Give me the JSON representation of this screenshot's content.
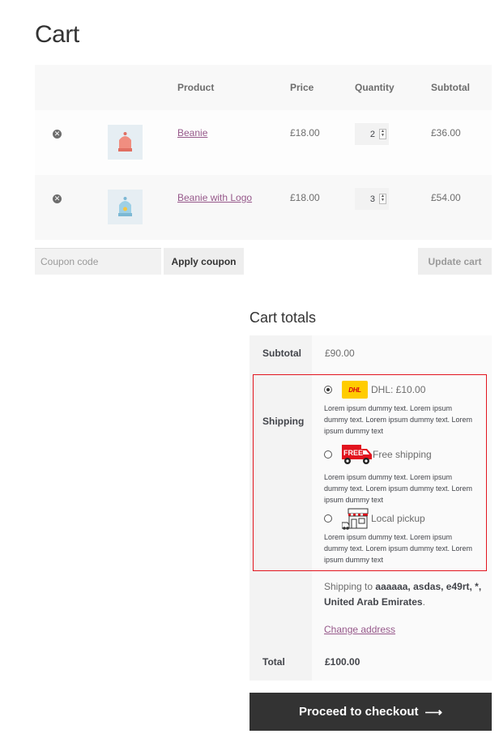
{
  "page": {
    "title": "Cart"
  },
  "cart_table": {
    "headers": {
      "product": "Product",
      "price": "Price",
      "quantity": "Quantity",
      "subtotal": "Subtotal"
    },
    "rows": [
      {
        "product": "Beanie",
        "price": "£18.00",
        "quantity": "2",
        "subtotal": "£36.00",
        "thumb_color": "#f08e80",
        "remove_icon": "close-circle-icon"
      },
      {
        "product": "Beanie with Logo",
        "price": "£18.00",
        "quantity": "3",
        "subtotal": "£54.00",
        "thumb_color": "#9ed0e6",
        "remove_icon": "close-circle-icon"
      }
    ]
  },
  "coupon": {
    "placeholder": "Coupon code",
    "value": "",
    "apply_label": "Apply coupon"
  },
  "update_label": "Update cart",
  "totals": {
    "title": "Cart totals",
    "subtotal_label": "Subtotal",
    "subtotal_value": "£90.00",
    "shipping_label": "Shipping",
    "shipping_options": [
      {
        "label": "DHL: £10.00",
        "selected": true,
        "icon": "dhl-logo-icon",
        "description": "Lorem ipsum dummy text. Lorem ipsum dummy text. Lorem ipsum dummy text. Lorem ipsum dummy text"
      },
      {
        "label": "Free shipping",
        "selected": false,
        "icon": "free-shipping-truck-icon",
        "description": "Lorem ipsum dummy text. Lorem ipsum dummy text. Lorem ipsum dummy text. Lorem ipsum dummy text"
      },
      {
        "label": "Local pickup",
        "selected": false,
        "icon": "store-pickup-icon",
        "description": "Lorem ipsum dummy text. Lorem ipsum dummy text. Lorem ipsum dummy text. Lorem ipsum dummy text"
      }
    ],
    "shipping_to_prefix": "Shipping to",
    "shipping_to_address": "aaaaaa, asdas, e49rt, *, United Arab Emirates",
    "shipping_to_suffix": ".",
    "change_address": "Change address",
    "total_label": "Total",
    "total_value": "£100.00"
  },
  "checkout": {
    "label": "Proceed to checkout",
    "arrow": "⟶"
  },
  "colors": {
    "accent_link": "#96588a",
    "highlight_border": "#e2141e",
    "checkout_bg": "#333333",
    "dhl_yellow": "#ffcc00",
    "dhl_red": "#d40511",
    "free_red": "#e2141e"
  }
}
